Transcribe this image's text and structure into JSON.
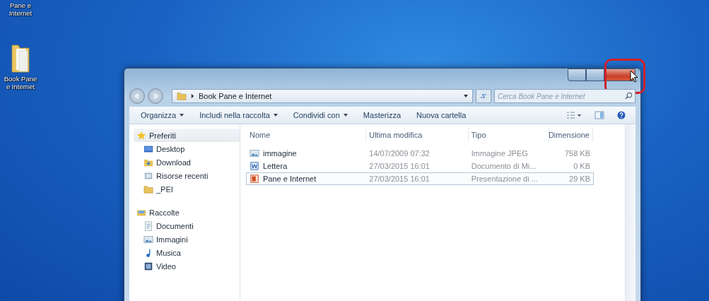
{
  "desktop_icons": [
    {
      "label": "Pane e Internet",
      "kind": "cut"
    },
    {
      "label": "Book Pane e Internet",
      "kind": "folder"
    }
  ],
  "window": {
    "close_highlighted": true,
    "address": "Book Pane e Internet",
    "search": {
      "placeholder": "Cerca Book Pane e Internet"
    }
  },
  "toolbar": [
    {
      "label": "Organizza",
      "dropdown": true
    },
    {
      "label": "Includi nella raccolta",
      "dropdown": true
    },
    {
      "label": "Condividi con",
      "dropdown": true
    },
    {
      "label": "Masterizza",
      "dropdown": false
    },
    {
      "label": "Nuova cartella",
      "dropdown": false
    }
  ],
  "sidebar": [
    {
      "label": "Preferiti",
      "kind": "star",
      "children": [
        {
          "label": "Desktop",
          "kind": "desktop"
        },
        {
          "label": "Download",
          "kind": "download"
        },
        {
          "label": "Risorse recenti",
          "kind": "recent"
        },
        {
          "label": "_PEI",
          "kind": "folder"
        }
      ]
    },
    {
      "label": "Raccolte",
      "kind": "library",
      "children": [
        {
          "label": "Documenti",
          "kind": "doc"
        },
        {
          "label": "Immagini",
          "kind": "image"
        },
        {
          "label": "Musica",
          "kind": "music"
        },
        {
          "label": "Video",
          "kind": "video"
        }
      ]
    }
  ],
  "table": {
    "columns": [
      "Nome",
      "Ultima modifica",
      "Tipo",
      "Dimensione"
    ],
    "rows": [
      {
        "kind": "image",
        "selected": false,
        "cells": [
          "immagine",
          "14/07/2009 07:32",
          "Immagine JPEG",
          "758 KB"
        ]
      },
      {
        "kind": "word",
        "selected": false,
        "cells": [
          "Lettera",
          "27/03/2015 16:01",
          "Documento di Mi...",
          "0 KB"
        ]
      },
      {
        "kind": "ppt",
        "selected": true,
        "cells": [
          "Pane e Internet",
          "27/03/2015 16:01",
          "Presentazione di ...",
          "29 KB"
        ]
      }
    ]
  }
}
